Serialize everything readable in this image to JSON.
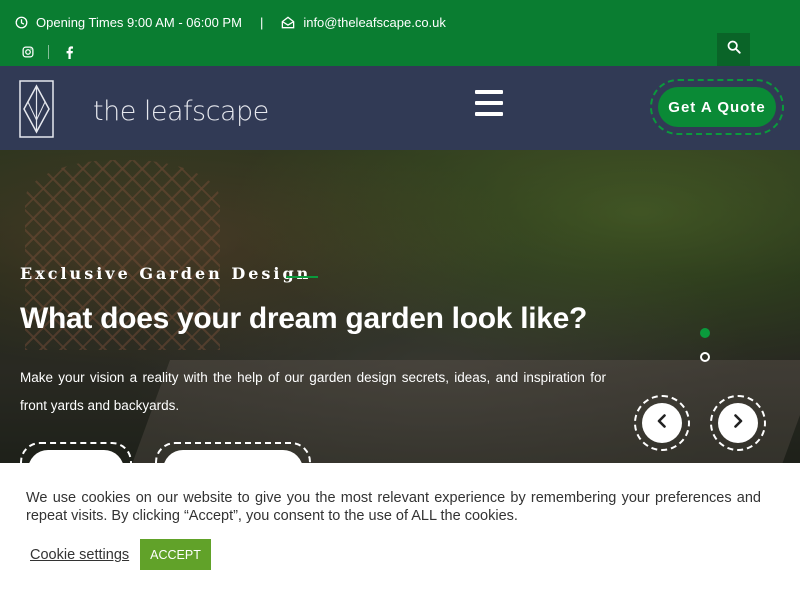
{
  "topbar": {
    "opening_times": "Opening Times 9:00 AM - 06:00 PM",
    "separator": "|",
    "email": "info@theleafscape.co.uk",
    "icons": {
      "clock": "clock-icon",
      "mail": "envelope-open-icon",
      "instagram": "instagram-icon",
      "facebook": "facebook-icon",
      "search": "search-icon"
    },
    "bg_color": "#0a7d31"
  },
  "header": {
    "logo_text": "the leafscape",
    "menu_icon": "hamburger-icon",
    "quote_label": "Get A Quote",
    "bg_color": "#313a55",
    "accent_color": "#0a8a36"
  },
  "hero": {
    "kicker": "Exclusive Garden Design",
    "headline": "What does your dream garden look like?",
    "description": "Make your vision a reality with the help of our garden design secrets, ideas, and inspiration for front yards and backyards.",
    "prev_icon": "chevron-left-icon",
    "next_icon": "chevron-right-icon"
  },
  "cookie": {
    "message": "We use cookies on our website to give you the most relevant experience by remembering your preferences and repeat visits. By clicking “Accept”, you consent to the use of ALL the cookies.",
    "settings_label": "Cookie settings",
    "accept_label": "ACCEPT",
    "accept_color": "#61a229"
  }
}
